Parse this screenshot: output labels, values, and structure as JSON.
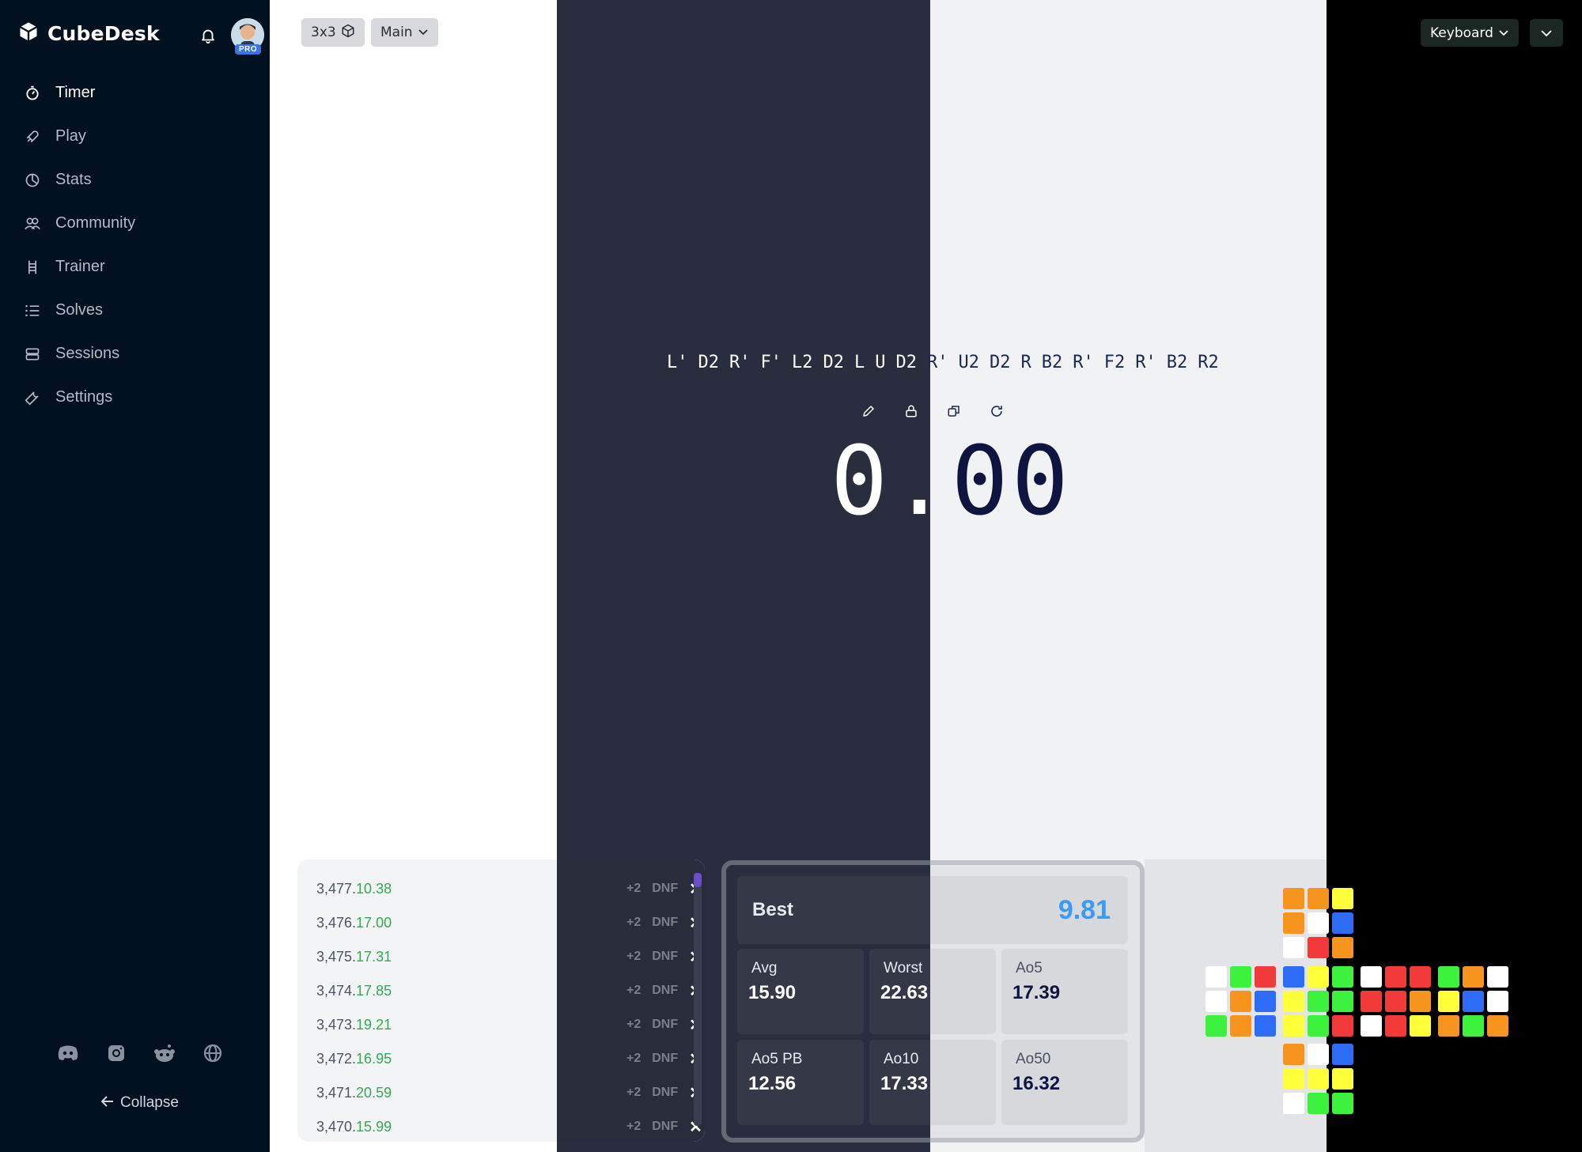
{
  "app": {
    "name": "CubeDesk",
    "badge": "PRO"
  },
  "nav": [
    {
      "label": "Timer",
      "icon": "timer-icon",
      "active": true
    },
    {
      "label": "Play",
      "icon": "rocket-icon",
      "active": false
    },
    {
      "label": "Stats",
      "icon": "pie-chart-icon",
      "active": false
    },
    {
      "label": "Community",
      "icon": "users-icon",
      "active": false
    },
    {
      "label": "Trainer",
      "icon": "ladder-icon",
      "active": false
    },
    {
      "label": "Solves",
      "icon": "list-icon",
      "active": false
    },
    {
      "label": "Sessions",
      "icon": "stack-icon",
      "active": false
    },
    {
      "label": "Settings",
      "icon": "wrench-icon",
      "active": false
    }
  ],
  "footer": {
    "collapse_label": "Collapse"
  },
  "toolbar": {
    "cube_type": "3x3",
    "session": "Main",
    "input_mode": "Keyboard"
  },
  "scramble": [
    "L'",
    "D2",
    "R'",
    "F'",
    "L2",
    "D2",
    "L",
    "U",
    "D2",
    "R'",
    "U2",
    "D2",
    "R",
    "B2",
    "R'",
    "F2",
    "R'",
    "B2",
    "R2"
  ],
  "timer": {
    "left": "0.",
    "right": "00"
  },
  "solves": [
    {
      "num": "3,477.",
      "time": "10.38"
    },
    {
      "num": "3,476.",
      "time": "17.00"
    },
    {
      "num": "3,475.",
      "time": "17.31"
    },
    {
      "num": "3,474.",
      "time": "17.85"
    },
    {
      "num": "3,473.",
      "time": "19.21"
    },
    {
      "num": "3,472.",
      "time": "16.95"
    },
    {
      "num": "3,471.",
      "time": "20.59"
    },
    {
      "num": "3,470.",
      "time": "15.99"
    }
  ],
  "solve_actions": {
    "plus2": "+2",
    "dnf": "DNF",
    "delete": "✕"
  },
  "stats": {
    "best": {
      "label": "Best",
      "value": "9.81"
    },
    "avg": {
      "label": "Avg",
      "value": "15.90"
    },
    "worst": {
      "label": "Worst",
      "value": "22.63"
    },
    "ao5": {
      "label": "Ao5",
      "value": "17.39"
    },
    "ao5pb": {
      "label": "Ao5 PB",
      "value": "12.56"
    },
    "ao10": {
      "label": "Ao10",
      "value": "17.33"
    },
    "ao50": {
      "label": "Ao50",
      "value": "16.32"
    }
  },
  "colors": {
    "orange": "#f7941d",
    "white": "#ffffff",
    "yellow": "#ffff3a",
    "blue": "#2d6cf6",
    "red": "#f23a3a",
    "green": "#3df23d",
    "accent_best": "#3b9af5",
    "solve_time": "#35a853"
  },
  "cube_net": {
    "up": [
      [
        "orange",
        "orange",
        "yellow"
      ],
      [
        "orange",
        "white",
        "blue"
      ],
      [
        "white",
        "red",
        "orange"
      ]
    ],
    "left": [
      [
        "white",
        "green",
        "red"
      ],
      [
        "white",
        "orange",
        "blue"
      ],
      [
        "green",
        "orange",
        "blue"
      ]
    ],
    "front": [
      [
        "blue",
        "yellow",
        "green"
      ],
      [
        "yellow",
        "green",
        "green"
      ],
      [
        "yellow",
        "green",
        "red"
      ]
    ],
    "right": [
      [
        "white",
        "red",
        "red"
      ],
      [
        "red",
        "red",
        "orange"
      ],
      [
        "white",
        "red",
        "yellow"
      ]
    ],
    "back": [
      [
        "green",
        "orange",
        "white"
      ],
      [
        "yellow",
        "blue",
        "white"
      ],
      [
        "orange",
        "green",
        "orange"
      ]
    ],
    "down": [
      [
        "orange",
        "white",
        "blue"
      ],
      [
        "yellow",
        "yellow",
        "yellow"
      ],
      [
        "white",
        "green",
        "green"
      ]
    ]
  }
}
